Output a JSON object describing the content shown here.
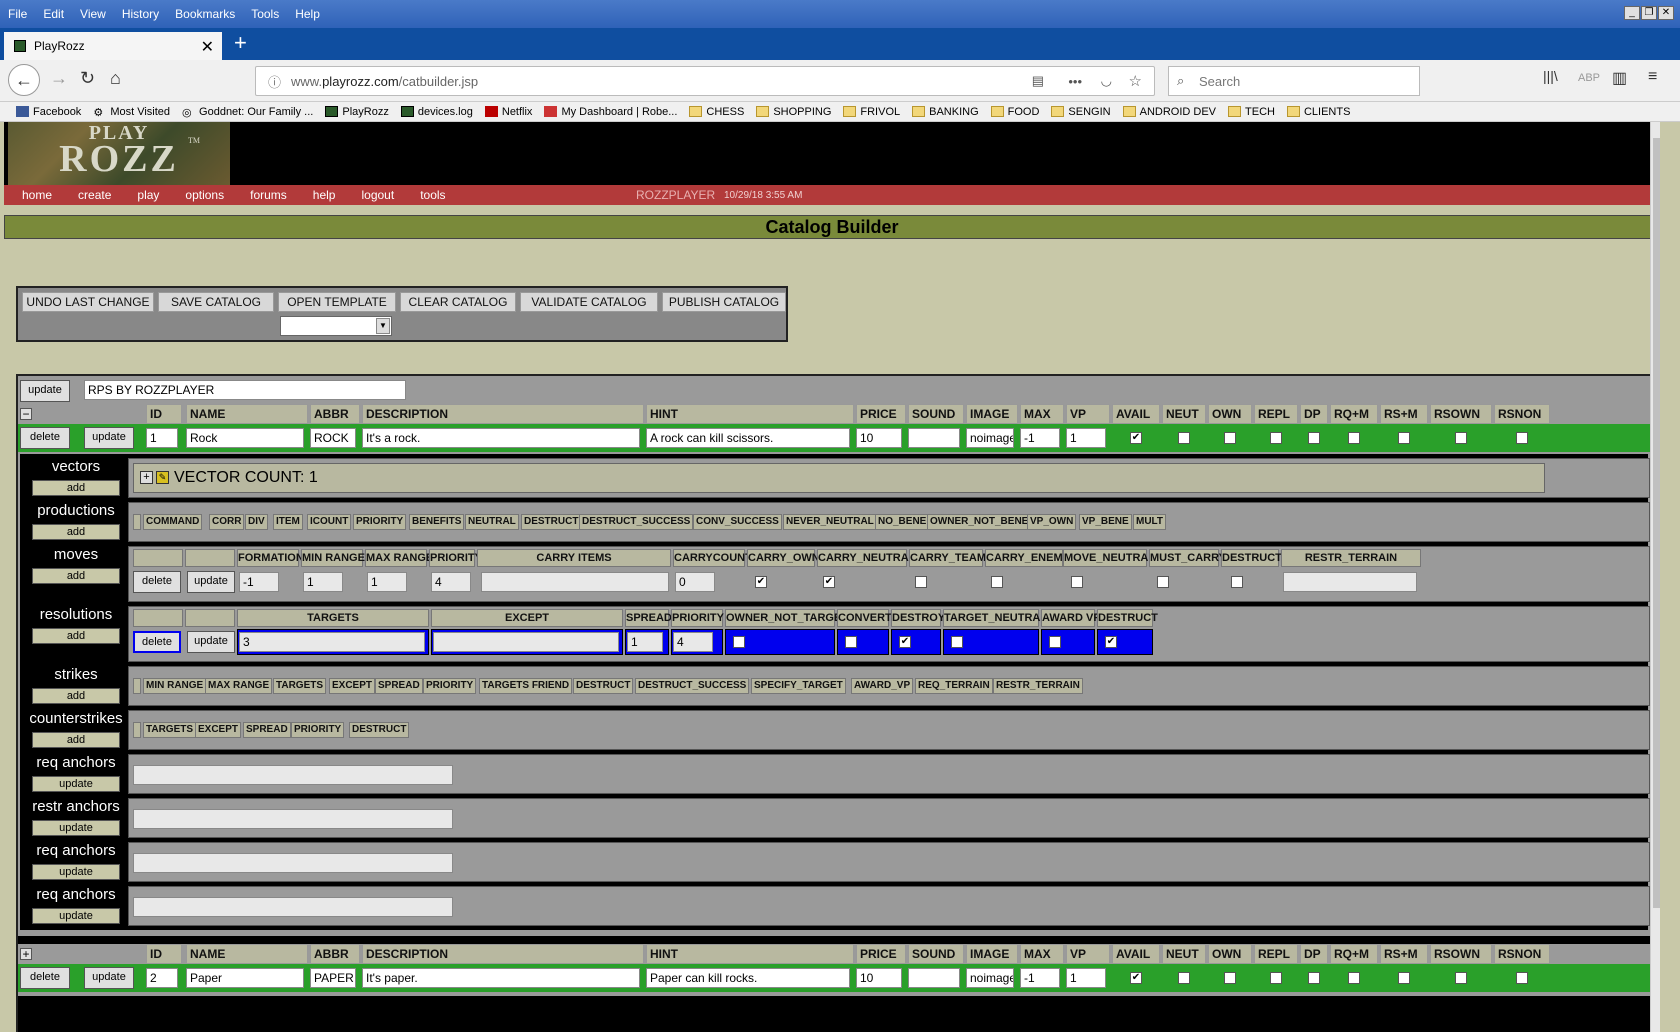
{
  "browser": {
    "menu": [
      "File",
      "Edit",
      "View",
      "History",
      "Bookmarks",
      "Tools",
      "Help"
    ],
    "tab_title": "PlayRozz",
    "url_prefix": "www.",
    "url_domain": "playrozz.com",
    "url_path": "/catbuilder.jsp",
    "search_placeholder": "Search",
    "bookmarks": [
      {
        "label": "Facebook",
        "icon": "facebook-icon"
      },
      {
        "label": "Most Visited",
        "icon": "gear-icon"
      },
      {
        "label": "Goddnet: Our Family ...",
        "icon": "globe-icon"
      },
      {
        "label": "PlayRozz",
        "icon": "playrozz-icon"
      },
      {
        "label": "devices.log",
        "icon": "playrozz-icon"
      },
      {
        "label": "Netflix",
        "icon": "netflix-icon"
      },
      {
        "label": "My Dashboard | Robe...",
        "icon": "dashboard-icon"
      },
      {
        "label": "CHESS",
        "icon": "folder-icon"
      },
      {
        "label": "SHOPPING",
        "icon": "folder-icon"
      },
      {
        "label": "FRIVOL",
        "icon": "folder-icon"
      },
      {
        "label": "BANKING",
        "icon": "folder-icon"
      },
      {
        "label": "FOOD",
        "icon": "folder-icon"
      },
      {
        "label": "SENGIN",
        "icon": "folder-icon"
      },
      {
        "label": "ANDROID DEV",
        "icon": "folder-icon"
      },
      {
        "label": "TECH",
        "icon": "folder-icon"
      },
      {
        "label": "CLIENTS",
        "icon": "folder-icon"
      }
    ]
  },
  "site": {
    "logo_top": "PLAY",
    "logo_bottom": "ROZZ",
    "logo_tm": "TM",
    "nav": [
      "home",
      "create",
      "play",
      "options",
      "forums",
      "help",
      "logout",
      "tools"
    ],
    "user": "ROZZPLAYER",
    "datetime": "10/29/18 3:55 AM",
    "page_title": "Catalog Builder"
  },
  "toolbar": {
    "buttons": [
      "UNDO LAST CHANGE",
      "SAVE CATALOG",
      "OPEN TEMPLATE",
      "CLEAR CATALOG",
      "VALIDATE CATALOG",
      "PUBLISH CATALOG"
    ]
  },
  "catalog": {
    "update_label": "update",
    "name_value": "RPS BY ROZZPLAYER",
    "columns": [
      "ID",
      "NAME",
      "ABBR",
      "DESCRIPTION",
      "HINT",
      "PRICE",
      "SOUND",
      "IMAGE",
      "MAX",
      "VP",
      "AVAIL",
      "NEUT",
      "OWN",
      "REPL",
      "DP",
      "RQ+M",
      "RS+M",
      "RSOWN",
      "RSNON"
    ],
    "delete_label": "delete",
    "collapse_symbol": "−",
    "expand_symbol": "+",
    "items": [
      {
        "id": "1",
        "name": "Rock",
        "abbr": "ROCK",
        "description": "It's a rock.",
        "hint": "A rock can kill scissors.",
        "price": "10",
        "sound": "",
        "image": "noimage",
        "max": "-1",
        "vp": "1"
      },
      {
        "id": "2",
        "name": "Paper",
        "abbr": "PAPER",
        "description": "It's paper.",
        "hint": "Paper can kill rocks.",
        "price": "10",
        "sound": "",
        "image": "noimage",
        "max": "-1",
        "vp": "1"
      }
    ]
  },
  "sections": {
    "vectors": "vectors",
    "productions": "productions",
    "moves": "moves",
    "resolutions": "resolutions",
    "strikes": "strikes",
    "counterstrikes": "counterstrikes",
    "req_anchors": "req anchors",
    "restr_anchors": "restr anchors",
    "add_label": "add",
    "update_label": "update",
    "vector_count": "VECTOR COUNT: 1",
    "productions_cols": [
      "COMMAND",
      "CORR",
      "DIV",
      "ITEM",
      "ICOUNT",
      "PRIORITY",
      "BENEFITS",
      "NEUTRAL",
      "DESTRUCT",
      "DESTRUCT_SUCCESS",
      "CONV_SUCCESS",
      "NEVER_NEUTRAL",
      "NO_BENE",
      "OWNER_NOT_BENE",
      "VP_OWN",
      "VP_BENE",
      "MULT"
    ],
    "moves_cols": [
      "FORMATION",
      "MIN RANGE",
      "MAX RANGE",
      "PRIORITY",
      "CARRY ITEMS",
      "CARRYCOUNT",
      "CARRY_OWN",
      "CARRY_NEUTRAL",
      "CARRY_TEAM",
      "CARRY_ENEMY",
      "MOVE_NEUTRAL",
      "MUST_CARRY",
      "DESTRUCT",
      "RESTR_TERRAIN"
    ],
    "moves_values": {
      "formation": "-1",
      "min_range": "1",
      "max_range": "1",
      "priority": "4",
      "carrycount": "0"
    },
    "resolutions_cols": [
      "TARGETS",
      "EXCEPT",
      "SPREAD",
      "PRIORITY",
      "OWNER_NOT_TARGET",
      "CONVERT",
      "DESTROY",
      "TARGET_NEUTRAL",
      "AWARD VP",
      "DESTRUCT"
    ],
    "resolutions_values": {
      "targets": "3",
      "except": "",
      "spread": "1",
      "priority": "4"
    },
    "strikes_cols": [
      "MIN RANGE",
      "MAX RANGE",
      "TARGETS",
      "EXCEPT",
      "SPREAD",
      "PRIORITY",
      "TARGETS FRIEND",
      "DESTRUCT",
      "DESTRUCT_SUCCESS",
      "SPECIFY_TARGET",
      "AWARD_VP",
      "REQ_TERRAIN",
      "RESTR_TERRAIN"
    ],
    "counterstrikes_cols": [
      "TARGETS",
      "EXCEPT",
      "SPREAD",
      "PRIORITY",
      "DESTRUCT"
    ]
  }
}
